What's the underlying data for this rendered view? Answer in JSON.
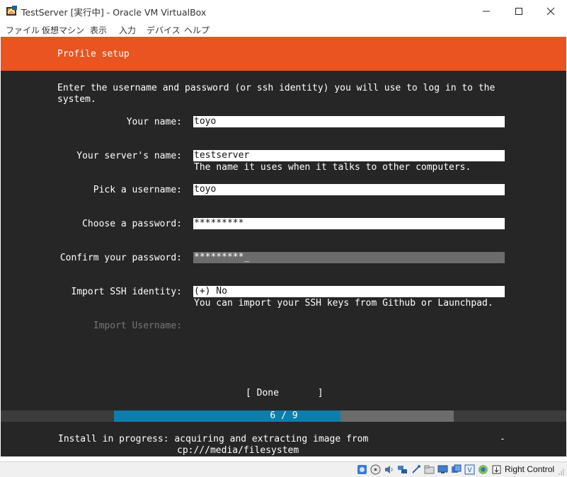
{
  "window": {
    "title": "TestServer [実行中] - Oracle VM VirtualBox",
    "menu": [
      "ファイル",
      "仮想マシン",
      "表示",
      "入力",
      "デバイス",
      "ヘルプ"
    ]
  },
  "installer": {
    "header": "Profile setup",
    "intro_line1": "Enter the username and password (or ssh identity) you will use to log in to the",
    "intro_line2": "system.",
    "fields": [
      {
        "label": "Your name:",
        "value": "toyo"
      },
      {
        "label": "Your server's name:",
        "value": "testserver",
        "hint": "The name it uses when it talks to other computers."
      },
      {
        "label": "Pick a username:",
        "value": "toyo"
      },
      {
        "label": "Choose a password:",
        "value": "*********"
      },
      {
        "label": "Confirm your password:",
        "value": "*********_"
      },
      {
        "label": "Import SSH identity:",
        "value": "(+) No",
        "hint": "You can import your SSH keys from Github or Launchpad."
      },
      {
        "label": "Import Username:"
      }
    ],
    "done_label": "[ Done       ]",
    "progress": {
      "label": "6 / 9",
      "fraction": 0.667
    },
    "status_line1": "Install in progress: acquiring and extracting image from",
    "status_line2": "cp:///media/filesystem",
    "status_spinner": "-"
  },
  "statusbar": {
    "host_key": "Right Control",
    "icons": [
      "hard-disk-icon",
      "optical-drive-icon",
      "audio-icon",
      "network-icon",
      "usb-icon",
      "shared-folders-icon",
      "display-icon",
      "recording-icon",
      "video-capture-icon",
      "cpu-icon",
      "mouse-integration-icon",
      "keyboard-icon"
    ]
  },
  "colors": {
    "accent": "#e95420",
    "console_bg": "#262626",
    "progress": "#0f7dab"
  }
}
